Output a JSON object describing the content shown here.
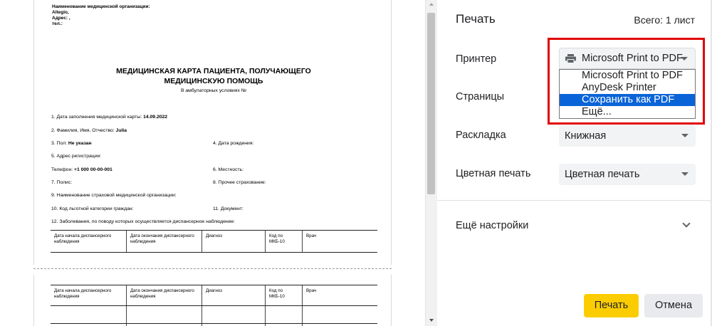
{
  "document": {
    "org_header": [
      "Наименование медицинской организации:",
      "Altegio,",
      "Адрес: ,",
      "тел.:"
    ],
    "title_line1": "МЕДИЦИНСКАЯ КАРТА ПАЦИЕНТА, ПОЛУЧАЮЩЕГО",
    "title_line2": "МЕДИЦИНСКУЮ ПОМОЩЬ",
    "subtitle": "В амбулаторных условиях №",
    "fields": {
      "f1_label": "1. Дата заполнения медицинской карты:",
      "f1_value": "14.09.2022",
      "f2_label": "2. Фамилия, Имя, Отчество:",
      "f2_value": "Julia",
      "f3_label": "3. Пол:",
      "f3_value": "Не указан",
      "f4_label": "4. Дата рождения:",
      "f5_label": "5. Адрес регистрации:",
      "phone_label": "Телефон:",
      "phone_value": "+1 000 00-00-001",
      "f6_label": "6. Местность:",
      "f7_label": "7. Полис:",
      "f8_label": "8. Прочее страхование:",
      "f9_label": "9. Наименование страховой медицинской организации:",
      "f10_label": "10. Код льготной категории граждан:",
      "f11_label": "11. Документ:",
      "f12_label": "12. Заболевания, по поводу которых осуществляется диспансерное наблюдение:"
    },
    "table_headers": [
      "Дата начала диспансерного наблюдения",
      "Дата окончания диспансерного наблюдения",
      "Диагноз",
      "Код по МКБ-10",
      "Врач"
    ]
  },
  "panel": {
    "title": "Печать",
    "total": "Всего: 1 лист",
    "printer_label": "Принтер",
    "printer_selected": "Microsoft Print to PDF",
    "printer_options": [
      "Microsoft Print to PDF",
      "AnyDesk Printer",
      "Сохранить как PDF",
      "Ещё..."
    ],
    "printer_highlighted_index": 2,
    "pages_label": "Страницы",
    "layout_label": "Раскладка",
    "layout_value": "Книжная",
    "color_label": "Цветная печать",
    "color_value": "Цветная печать",
    "more_settings": "Ещё настройки",
    "print_button": "Печать",
    "cancel_button": "Отмена"
  },
  "colors": {
    "print_button_bg": "#fbcd00",
    "highlight_border": "#e00000",
    "dropdown_selected_bg": "#0a64d8"
  }
}
